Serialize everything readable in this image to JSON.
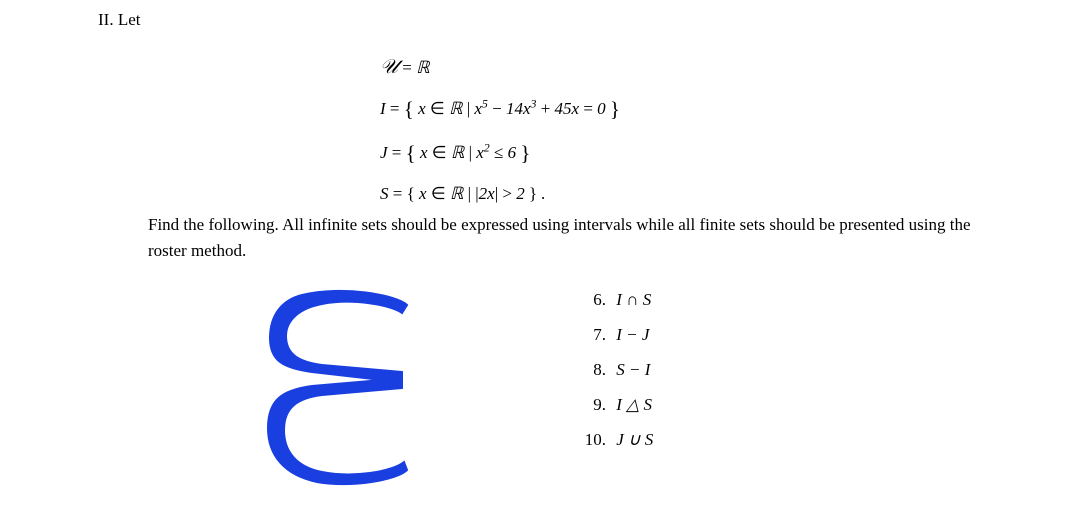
{
  "heading": {
    "numeral": "II.",
    "label": "Let"
  },
  "definitions": {
    "u_line": "𝒰 = ℝ",
    "i_line": "I = { x ∈ ℝ | x⁵ − 14x³ + 45x = 0 }",
    "j_line": "J = { x ∈ ℝ | x² ≤ 6 }",
    "s_line": "S = { x ∈ ℝ | |2x| > 2 } ."
  },
  "instructions": "Find the following. All infinite sets should be expressed using intervals while all finite sets should be presented using the roster method.",
  "annotation_glyph": "E",
  "subitems": [
    {
      "num": "6.",
      "expr": "I ∩ S"
    },
    {
      "num": "7.",
      "expr": "I − J"
    },
    {
      "num": "8.",
      "expr": "S − I"
    },
    {
      "num": "9.",
      "expr": "I △ S"
    },
    {
      "num": "10.",
      "expr": "J ∪ S"
    }
  ],
  "chart_data": {
    "type": "table",
    "title": "Set definitions and operations problem",
    "sets": {
      "U": "ℝ (universal set)",
      "I": "{ x ∈ ℝ | x⁵ − 14x³ + 45x = 0 }",
      "J": "{ x ∈ ℝ | x² ≤ 6 }",
      "S": "{ x ∈ ℝ | |2x| > 2 }"
    },
    "questions": [
      "6. I ∩ S",
      "7. I − J",
      "8. S − I",
      "9. I △ S",
      "10. J ∪ S"
    ]
  }
}
